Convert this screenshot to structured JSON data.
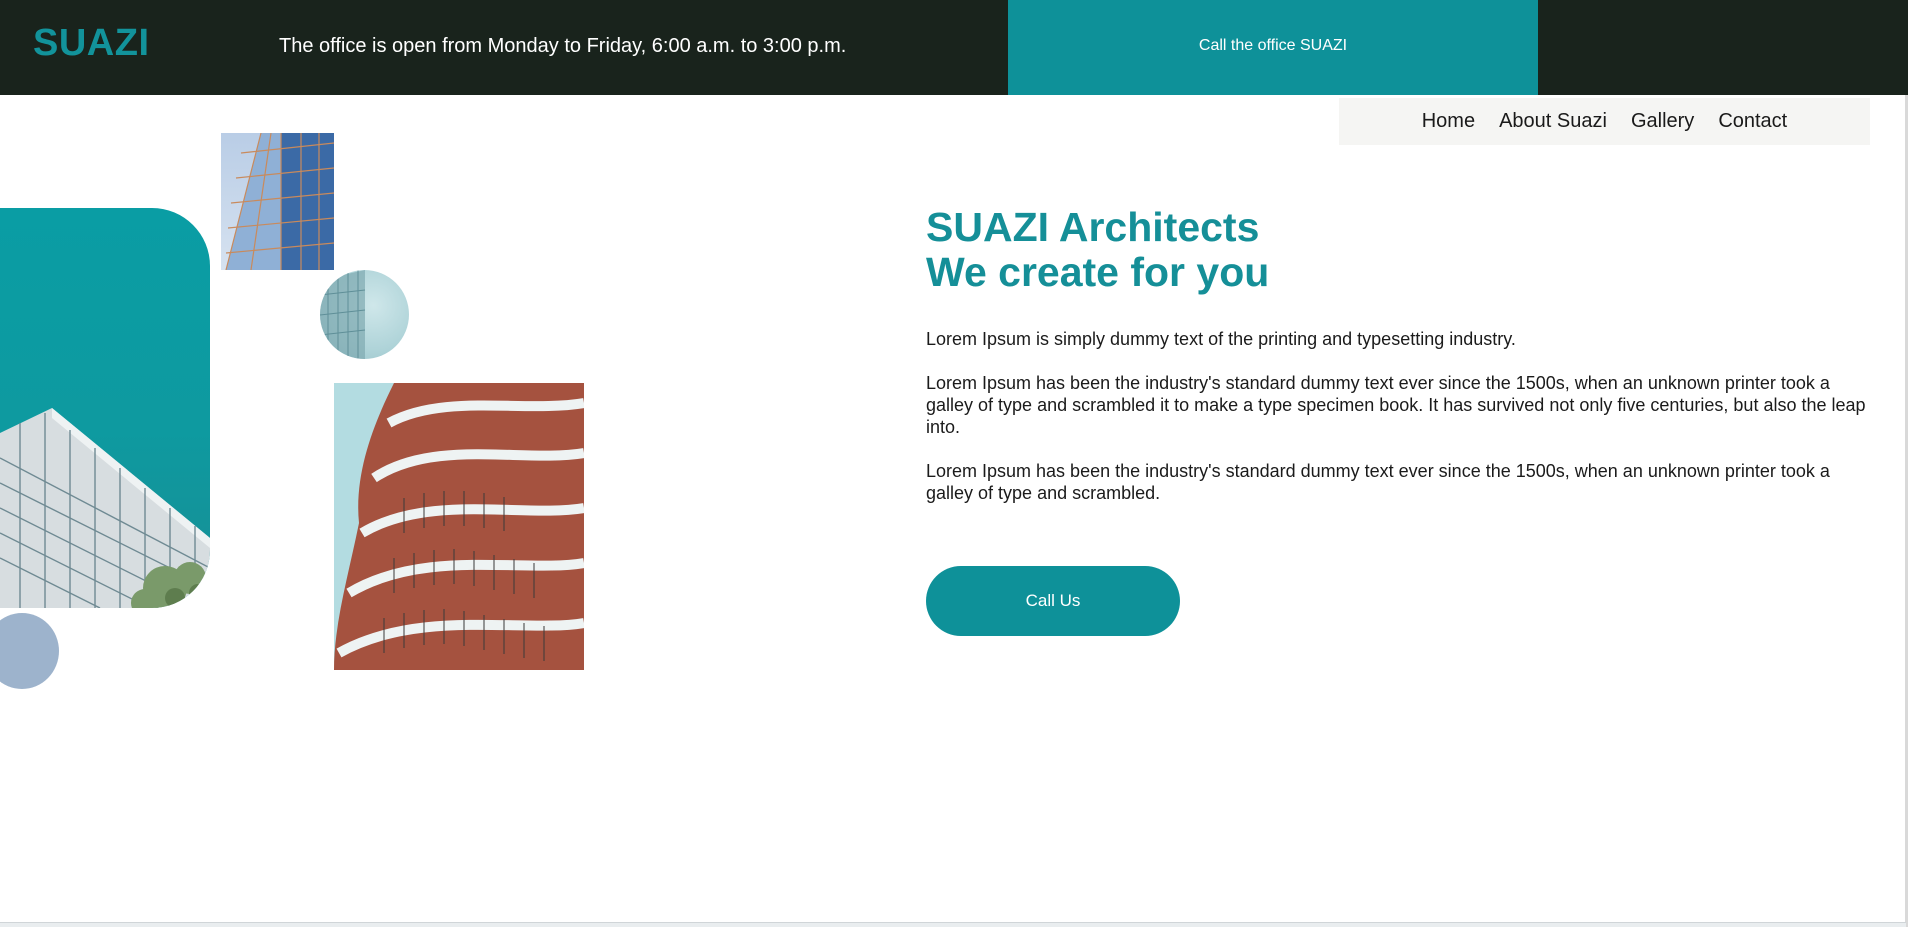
{
  "header": {
    "logo": "SUAZI",
    "hours": "The office is open from Monday to Friday, 6:00 a.m. to 3:00 p.m.",
    "call_office_label": "Call the office SUAZI"
  },
  "nav": {
    "items": [
      {
        "label": "Home"
      },
      {
        "label": "About Suazi"
      },
      {
        "label": "Gallery"
      },
      {
        "label": "Contact"
      }
    ]
  },
  "hero": {
    "title_line1": "SUAZI Architects",
    "title_line2": "We create for you",
    "paragraphs": [
      "Lorem Ipsum is simply dummy text of the printing and typesetting industry.",
      "Lorem Ipsum has been the industry's standard dummy text ever since the 1500s, when an unknown printer took a galley of type and scrambled it to make a type specimen book. It has survived not only five centuries, but also the leap into.",
      "Lorem Ipsum has been the industry's standard dummy text ever since the 1500s, when an unknown printer took a galley of type and scrambled."
    ],
    "cta_label": "Call Us"
  },
  "colors": {
    "topbar": "#19231c",
    "accent": "#0e9199",
    "title": "#158f98",
    "nav_bg": "#f5f5f3",
    "dot": "#9db3cc"
  },
  "images": [
    {
      "name": "building-teal-sky-image"
    },
    {
      "name": "glass-tower-image"
    },
    {
      "name": "glass-tower-circle-image"
    },
    {
      "name": "curved-balcony-building-image"
    }
  ]
}
